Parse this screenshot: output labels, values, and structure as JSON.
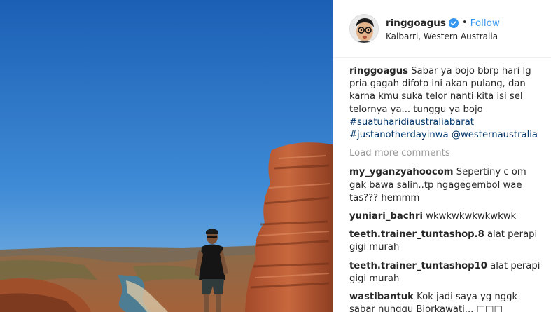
{
  "header": {
    "username": "ringgoagus",
    "separator": "•",
    "follow_label": "Follow",
    "location": "Kalbarri, Western Australia"
  },
  "caption": {
    "username": "ringgoagus",
    "text": "Sabar ya bojo bbrp hari lg pria gagah difoto ini akan pulang, dan karna kmu suka telor nanti kita isi sel telornya ya... tunggu ya bojo",
    "hashtag1": "#suatuharidiaustraliabarat",
    "hashtag2": "#justanotherdayinwa",
    "mention": "@westernaustralia"
  },
  "load_more_label": "Load more comments",
  "comments": [
    {
      "username": "my_yganzyahoocom",
      "text": "Sepertiny c om gak bawa salin..tp ngagegembol wae tas??? hemmm"
    },
    {
      "username": "yuniari_bachri",
      "text": "wkwkwkwkwkwkwk"
    },
    {
      "username": "teeth.trainer_tuntashop.8",
      "text": "alat perapi gigi murah"
    },
    {
      "username": "teeth.trainer_tuntashop10",
      "text": "alat perapi gigi murah"
    },
    {
      "username": "wastibantuk",
      "text": "Kok jadi saya yg nggk sabar nunggu Bjorkawati... □□□"
    }
  ],
  "colors": {
    "link_blue": "#3897f0",
    "hashtag_blue": "#003569",
    "muted_gray": "#999999",
    "sky_top": "#1c63b8",
    "sky_bottom": "#5aa0de"
  },
  "icons": {
    "verified": "verified-badge-icon"
  }
}
